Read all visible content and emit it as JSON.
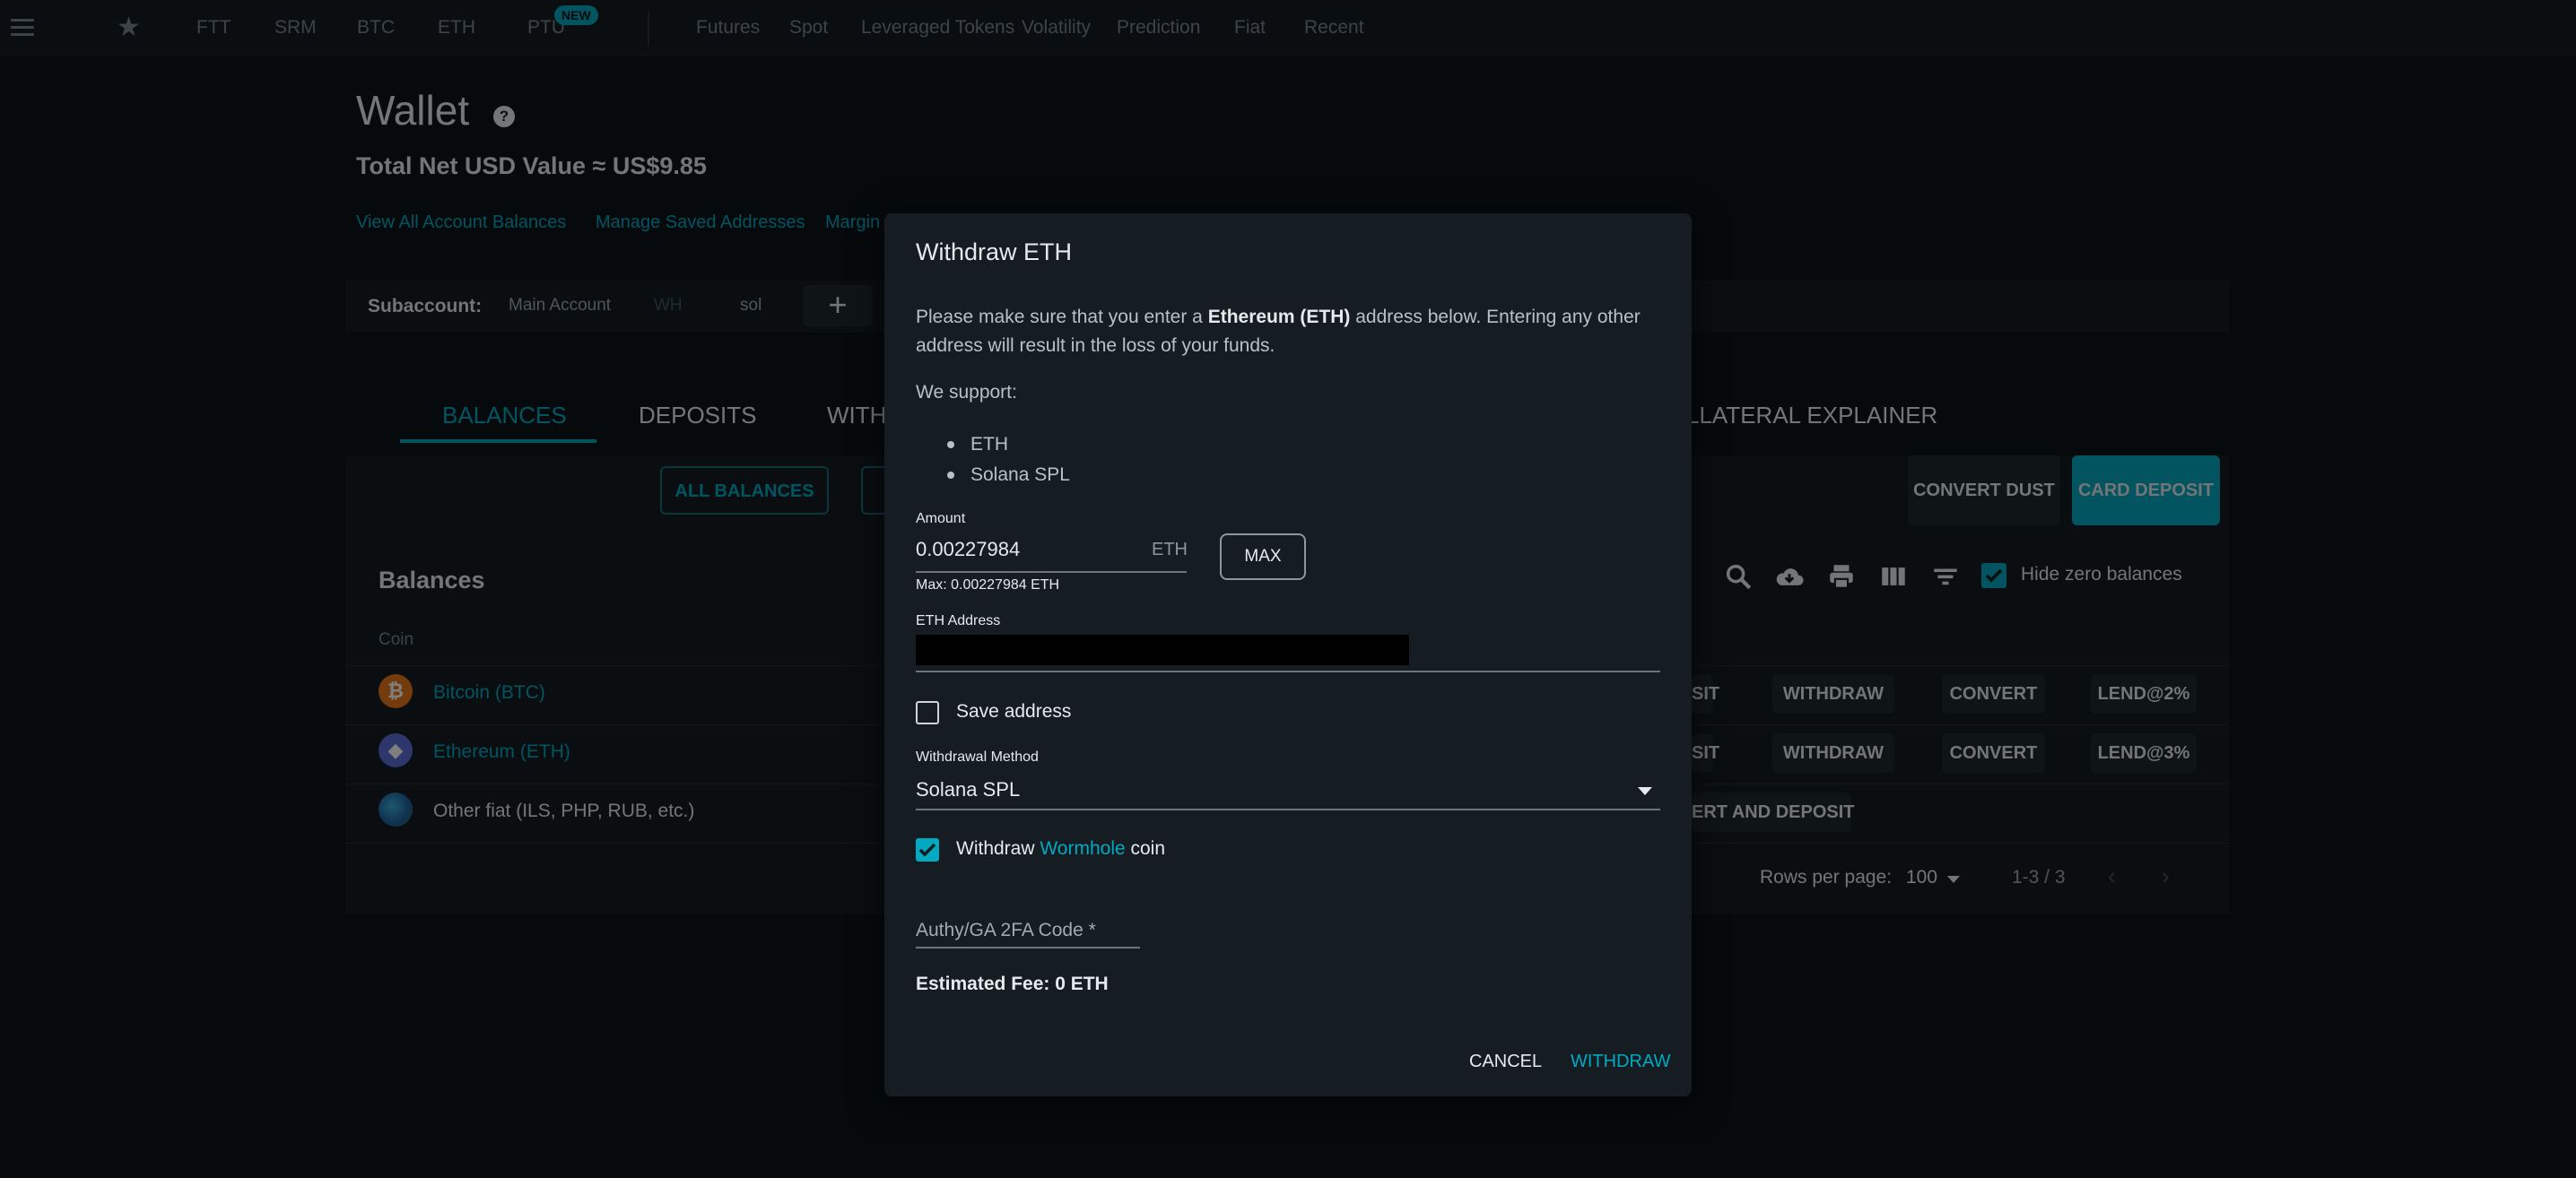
{
  "nav": {
    "items": [
      "FTT",
      "SRM",
      "BTC",
      "ETH",
      "PTU"
    ],
    "new_badge": "NEW",
    "sections": [
      "Futures",
      "Spot",
      "Leveraged Tokens",
      "Volatility",
      "Prediction",
      "Fiat",
      "Recent"
    ]
  },
  "wallet": {
    "title": "Wallet",
    "help": "?",
    "net_value": "Total Net USD Value ≈ US$9.85",
    "links": [
      "View All Account Balances",
      "Manage Saved Addresses",
      "Margin"
    ],
    "subaccount_label": "Subaccount:",
    "subaccounts": [
      "Main Account",
      "WH",
      "sol"
    ],
    "add_sub": "+",
    "tabs": [
      "BALANCES",
      "DEPOSITS",
      "WITH",
      "LLATERAL EXPLAINER"
    ],
    "all_balances": "ALL BALANCES",
    "convert_dust": "CONVERT DUST",
    "card_deposit": "CARD DEPOSIT",
    "balances_title": "Balances",
    "coin_header": "Coin",
    "hide_zero": "Hide zero balances",
    "rows": [
      {
        "name": "Bitcoin (BTC)",
        "dep": "SIT",
        "withdraw": "WITHDRAW",
        "convert": "CONVERT",
        "lend": "LEND@2%"
      },
      {
        "name": "Ethereum (ETH)",
        "dep": "SIT",
        "withdraw": "WITHDRAW",
        "convert": "CONVERT",
        "lend": "LEND@3%"
      },
      {
        "name": "Other fiat (ILS, PHP, RUB, etc.)",
        "convdep": "ERT AND DEPOSIT"
      }
    ],
    "rows_per_page_label": "Rows per page:",
    "rows_per_page": "100",
    "range": "1-3 / 3"
  },
  "modal": {
    "title": "Withdraw ETH",
    "warn_pre": "Please make sure that you enter a ",
    "warn_bold": "Ethereum (ETH)",
    "warn_post": " address below. Entering any other",
    "warn_line2": "address will result in the loss of your funds.",
    "support_label": "We support:",
    "support_list": [
      "ETH",
      "Solana SPL"
    ],
    "amount_label": "Amount",
    "amount_value": "0.00227984",
    "amount_unit": "ETH",
    "max_button": "MAX",
    "max_hint": "Max: 0.00227984 ETH",
    "address_label": "ETH Address",
    "save_address": "Save address",
    "method_label": "Withdrawal Method",
    "method_value": "Solana SPL",
    "wormhole_pre": "Withdraw ",
    "wormhole_link": "Wormhole",
    "wormhole_post": " coin",
    "twofa_placeholder": "Authy/GA 2FA Code *",
    "fee": "Estimated Fee: 0 ETH",
    "cancel": "CANCEL",
    "withdraw": "WITHDRAW"
  }
}
